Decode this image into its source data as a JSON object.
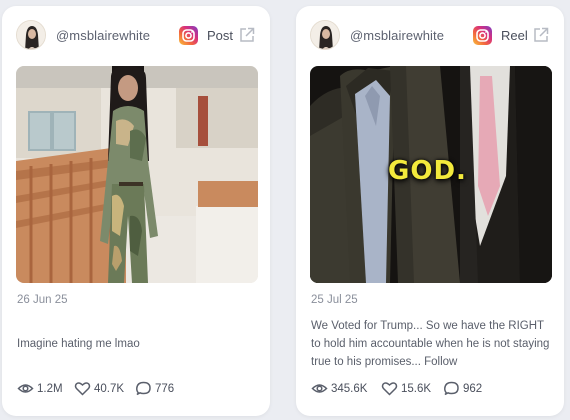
{
  "cards": [
    {
      "username": "@msblairewhite",
      "platform_icon": "instagram-icon",
      "post_type": "Post",
      "date": "26 Jun 25",
      "caption": "Imagine hating me lmao",
      "stats": {
        "views": "1.2M",
        "likes": "40.7K",
        "comments": "776"
      }
    },
    {
      "username": "@msblairewhite",
      "platform_icon": "instagram-icon",
      "post_type": "Reel",
      "media_overlay_text": "GOD.",
      "date": "25 Jul 25",
      "caption": "We Voted for Trump... So we have the RIGHT to hold him accountable when he is not staying true to his promises... Follow",
      "stats": {
        "views": "345.6K",
        "likes": "15.6K",
        "comments": "962"
      }
    }
  ],
  "colors": {
    "background": "#ebedf2",
    "card": "#ffffff",
    "text": "#4a4f5c",
    "muted": "#8a8f9b",
    "overlay_text": "#f3ea3c"
  }
}
